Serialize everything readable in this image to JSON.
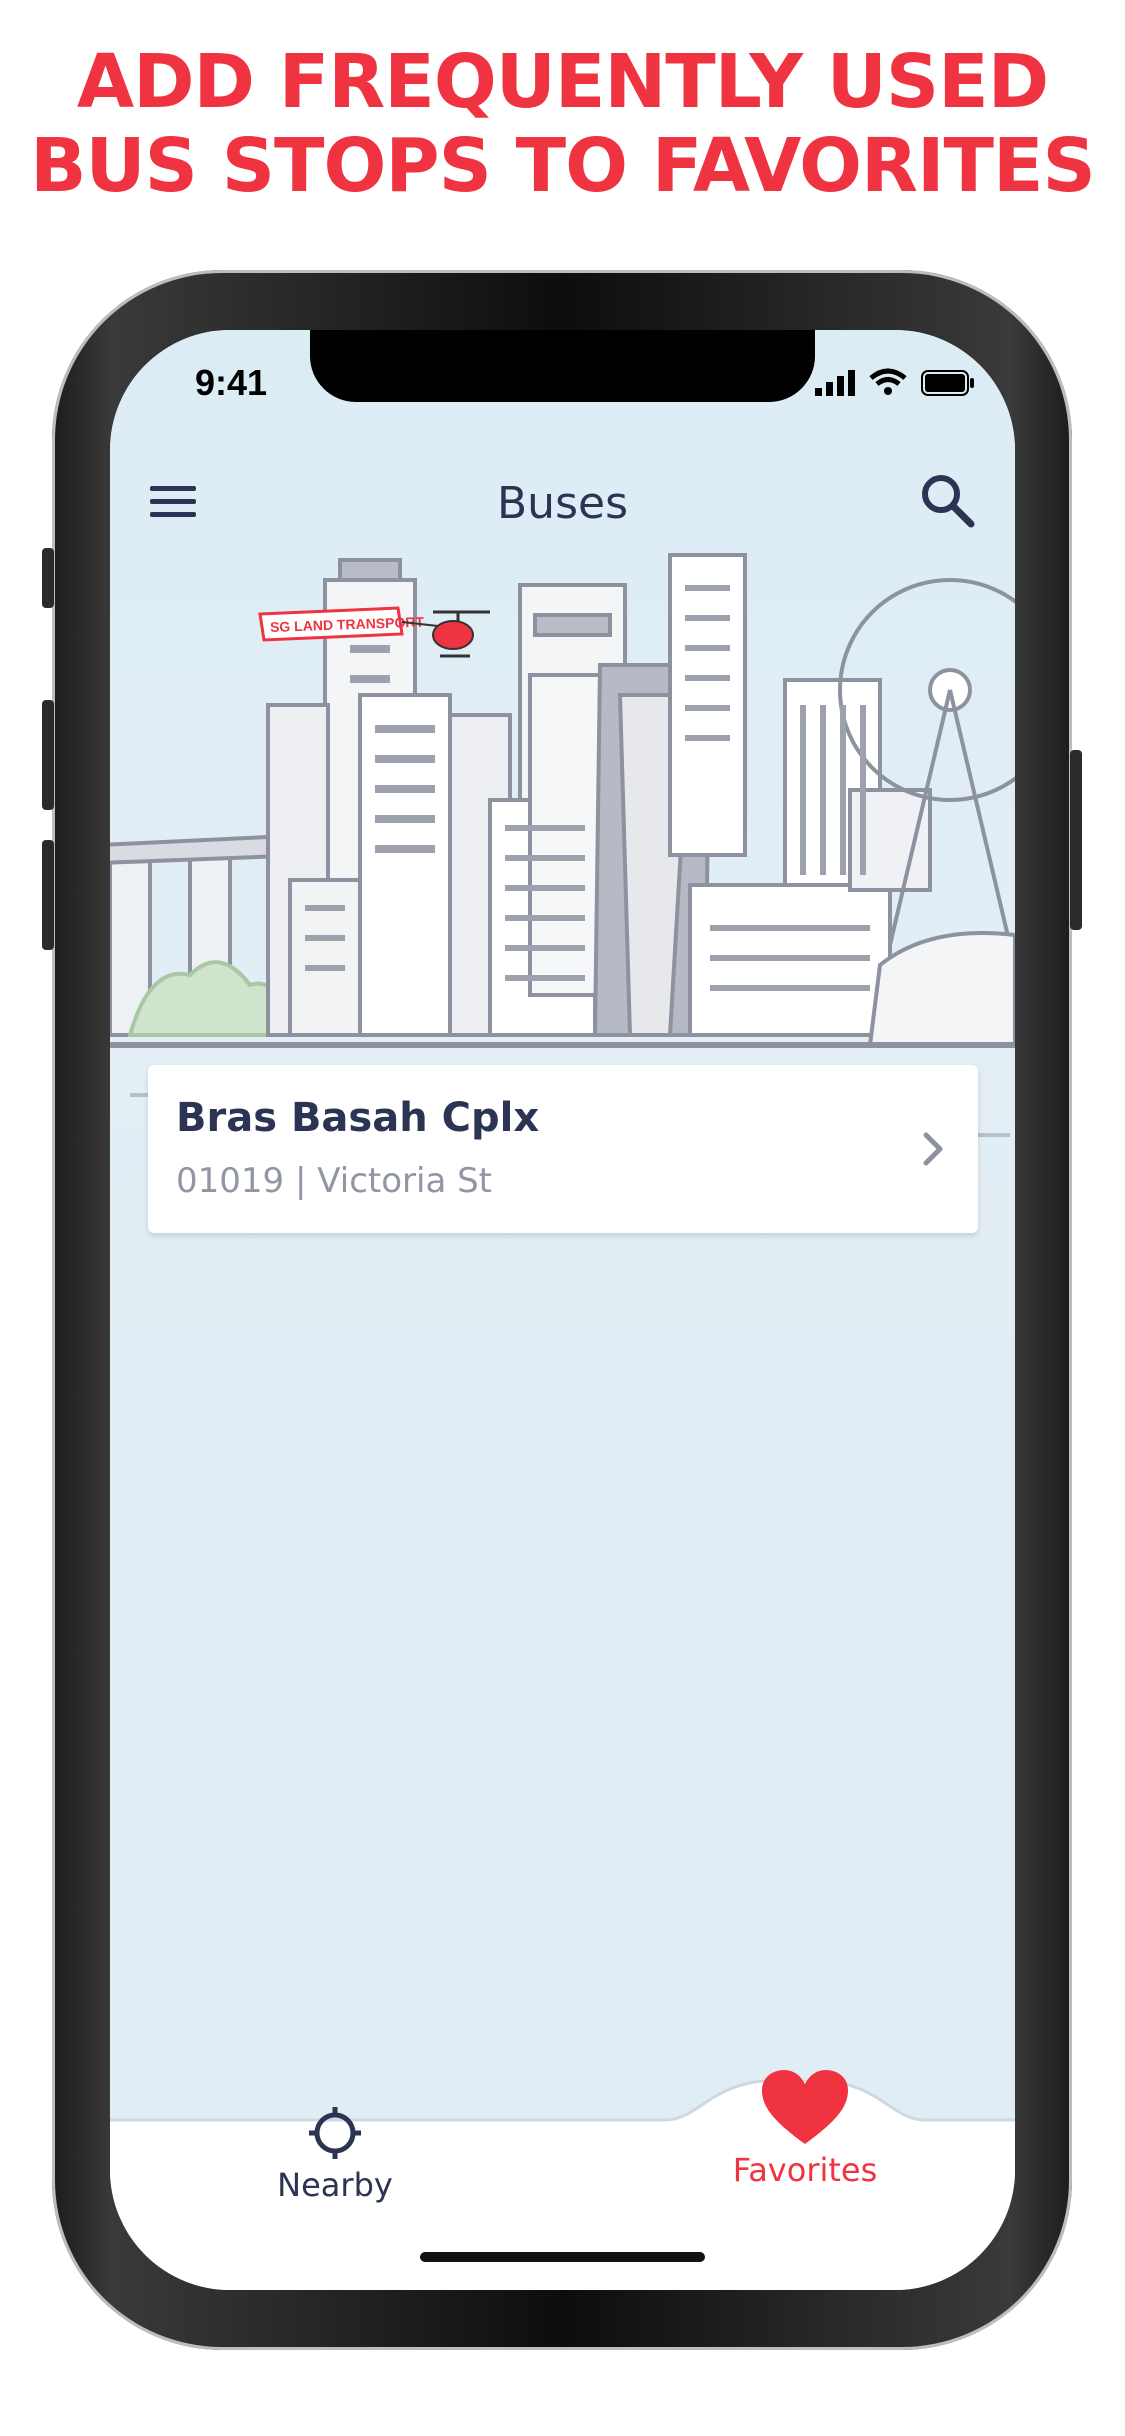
{
  "headline": {
    "line1": "ADD FREQUENTLY USED",
    "line2": "BUS STOPS TO FAVORITES"
  },
  "status_bar": {
    "time": "9:41",
    "icons": [
      "cellular-signal-icon",
      "wifi-icon",
      "battery-icon"
    ]
  },
  "app_bar": {
    "title": "Buses",
    "left_icon": "menu-icon",
    "right_icon": "search-icon"
  },
  "banner": {
    "helicopter_banner_text": "SG LAND TRANSPORT"
  },
  "favorites": [
    {
      "name": "Bras Basah Cplx",
      "details": "01019 | Victoria St"
    }
  ],
  "tabs": [
    {
      "label": "Nearby",
      "icon": "crosshair-icon",
      "active": false
    },
    {
      "label": "Favorites",
      "icon": "heart-icon",
      "active": true
    }
  ],
  "colors": {
    "accent": "#ef3340",
    "text_primary": "#2b3452",
    "text_secondary": "#9196a4",
    "screen_bg": "#e1edf4",
    "skyline_line": "#8e92a0"
  }
}
